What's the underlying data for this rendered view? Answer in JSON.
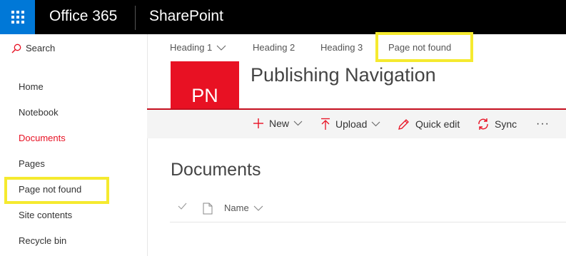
{
  "suitebar": {
    "app_launcher_icon": "waffle-icon",
    "brand": "Office 365",
    "app_name": "SharePoint",
    "accent_color": "#0078d7"
  },
  "leftnav": {
    "search_label": "Search",
    "items": [
      {
        "label": "Home",
        "active": false
      },
      {
        "label": "Notebook",
        "active": false
      },
      {
        "label": "Documents",
        "active": true
      },
      {
        "label": "Pages",
        "active": false
      },
      {
        "label": "Page not found",
        "active": false,
        "highlighted": true
      },
      {
        "label": "Site contents",
        "active": false
      },
      {
        "label": "Recycle bin",
        "active": false
      }
    ]
  },
  "top_nav": {
    "items": [
      {
        "label": "Heading 1",
        "has_dropdown": true
      },
      {
        "label": "Heading 2",
        "has_dropdown": false
      },
      {
        "label": "Heading 3",
        "has_dropdown": false
      },
      {
        "label": "Page not found",
        "has_dropdown": false,
        "highlighted": true
      }
    ]
  },
  "site": {
    "logo_initials": "PN",
    "title": "Publishing Navigation",
    "brand_color": "#e81123"
  },
  "command_bar": {
    "new_label": "New",
    "upload_label": "Upload",
    "quick_edit_label": "Quick edit",
    "sync_label": "Sync",
    "more_label": "···"
  },
  "library": {
    "heading": "Documents",
    "columns": {
      "name_label": "Name"
    }
  },
  "highlight_color": "#f5ea2f"
}
